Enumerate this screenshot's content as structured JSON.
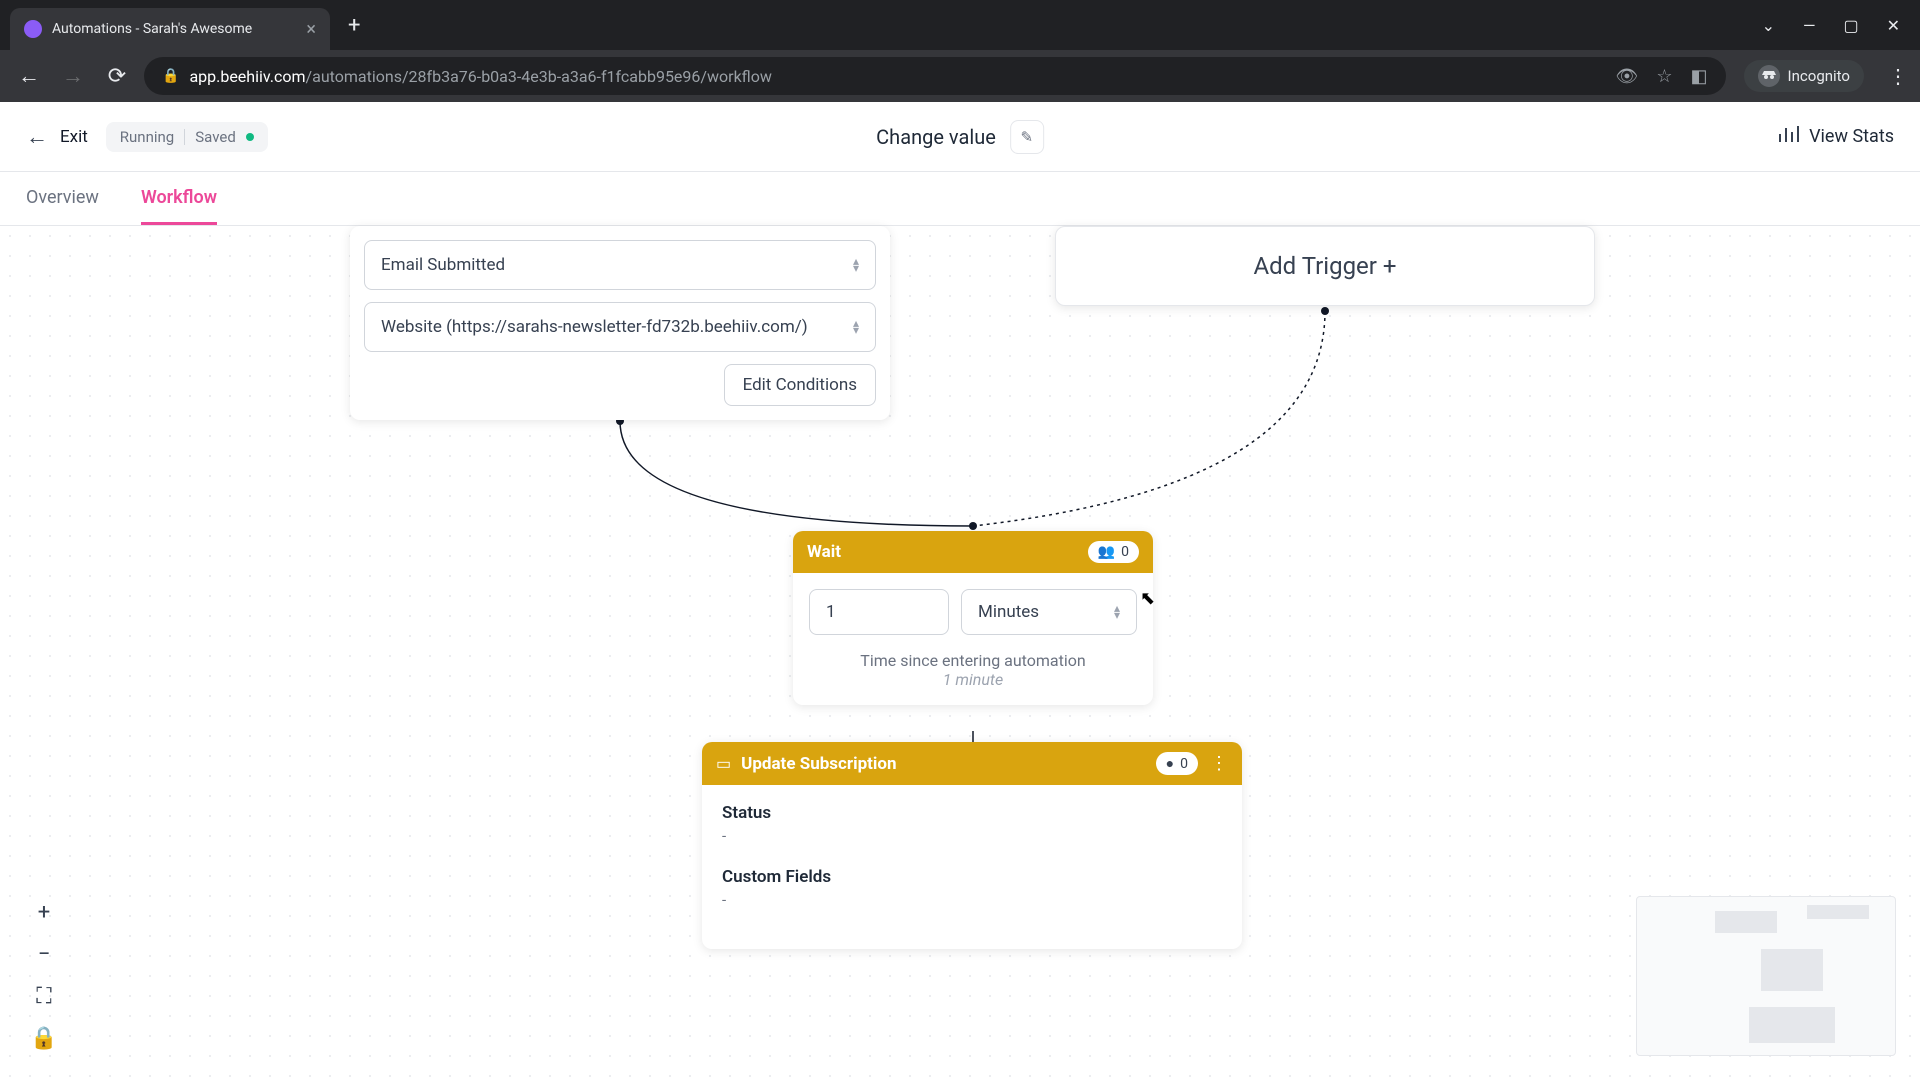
{
  "browser": {
    "tab_title": "Automations - Sarah's Awesome",
    "url_domain": "app.beehiiv.com",
    "url_path": "/automations/28fb3a76-b0a3-4e3b-a3a6-f1fcabb95e96/workflow",
    "incognito_label": "Incognito"
  },
  "header": {
    "exit_label": "Exit",
    "status_running": "Running",
    "status_saved": "Saved",
    "page_title": "Change value",
    "view_stats_label": "View Stats"
  },
  "nav_tabs": {
    "overview": "Overview",
    "workflow": "Workflow"
  },
  "trigger": {
    "event": "Email Submitted",
    "source": "Website (https://sarahs-newsletter-fd732b.beehiiv.com/)",
    "edit_conditions": "Edit Conditions"
  },
  "add_trigger": {
    "label": "Add Trigger +"
  },
  "wait": {
    "title": "Wait",
    "count": "0",
    "value": "1",
    "unit": "Minutes",
    "caption": "Time since entering automation",
    "subcaption": "1 minute"
  },
  "update": {
    "title": "Update Subscription",
    "count": "0",
    "status_label": "Status",
    "status_value": "-",
    "custom_fields_label": "Custom Fields",
    "custom_fields_value": "-"
  }
}
